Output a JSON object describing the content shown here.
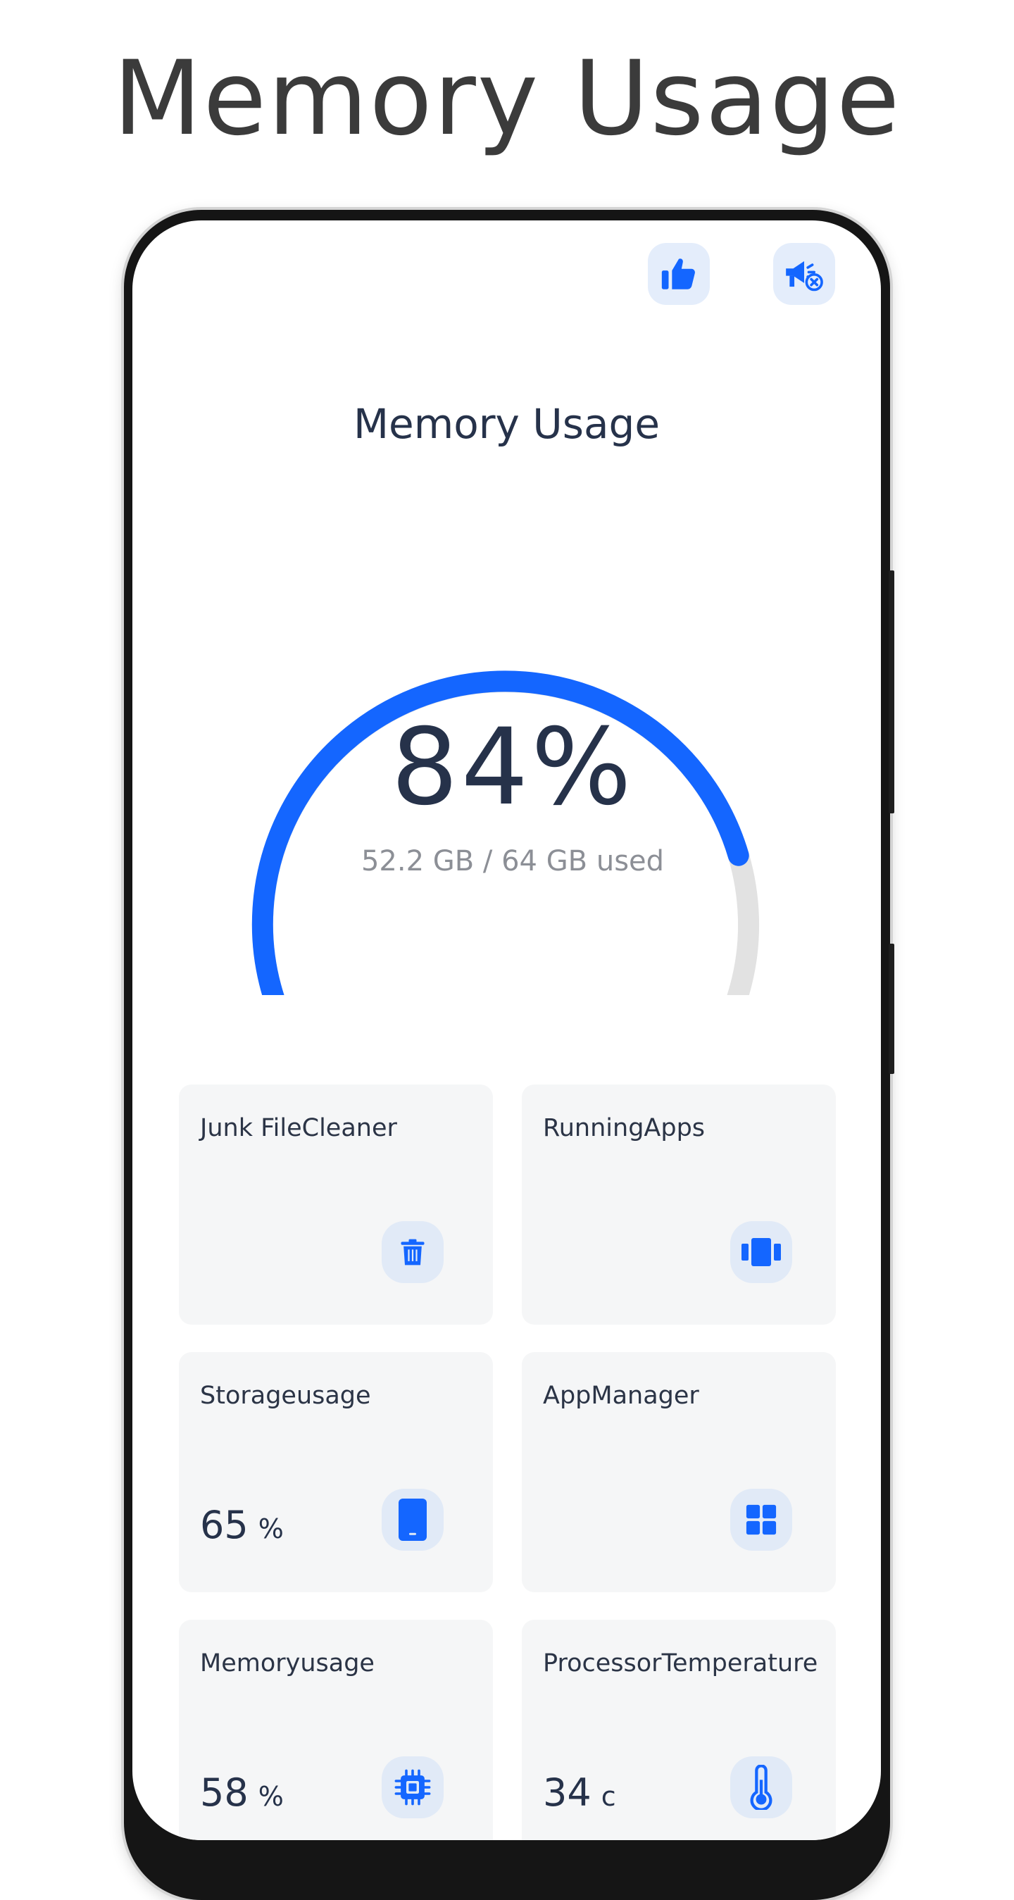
{
  "headline": "Memory Usage",
  "screen_title": "Memory Usage",
  "top_buttons": [
    {
      "icon": "thumbs-up-icon"
    },
    {
      "icon": "remove-ads-icon"
    }
  ],
  "gauge": {
    "percent_label": "84%",
    "detail": "52.2 GB / 64 GB used",
    "fraction": 0.84,
    "used_gb": 52.2,
    "total_gb": 64
  },
  "cards": [
    {
      "title": "Junk FileCleaner",
      "value": "",
      "unit": "",
      "icon": "trash-icon"
    },
    {
      "title": "RunningApps",
      "value": "",
      "unit": "",
      "icon": "running-apps-icon"
    },
    {
      "title": "Storageusage",
      "value": "65",
      "unit": "%",
      "icon": "phone-icon"
    },
    {
      "title": "AppManager",
      "value": "",
      "unit": "",
      "icon": "app-grid-icon"
    },
    {
      "title": "Memoryusage",
      "value": "58",
      "unit": "%",
      "icon": "chip-icon"
    },
    {
      "title": "ProcessorTemperature",
      "value": "34",
      "unit": "c",
      "icon": "thermometer-icon"
    }
  ],
  "colors": {
    "accent": "#1466ff",
    "track": "#e2e2e2",
    "icon_bg": "#e1eaf7"
  }
}
